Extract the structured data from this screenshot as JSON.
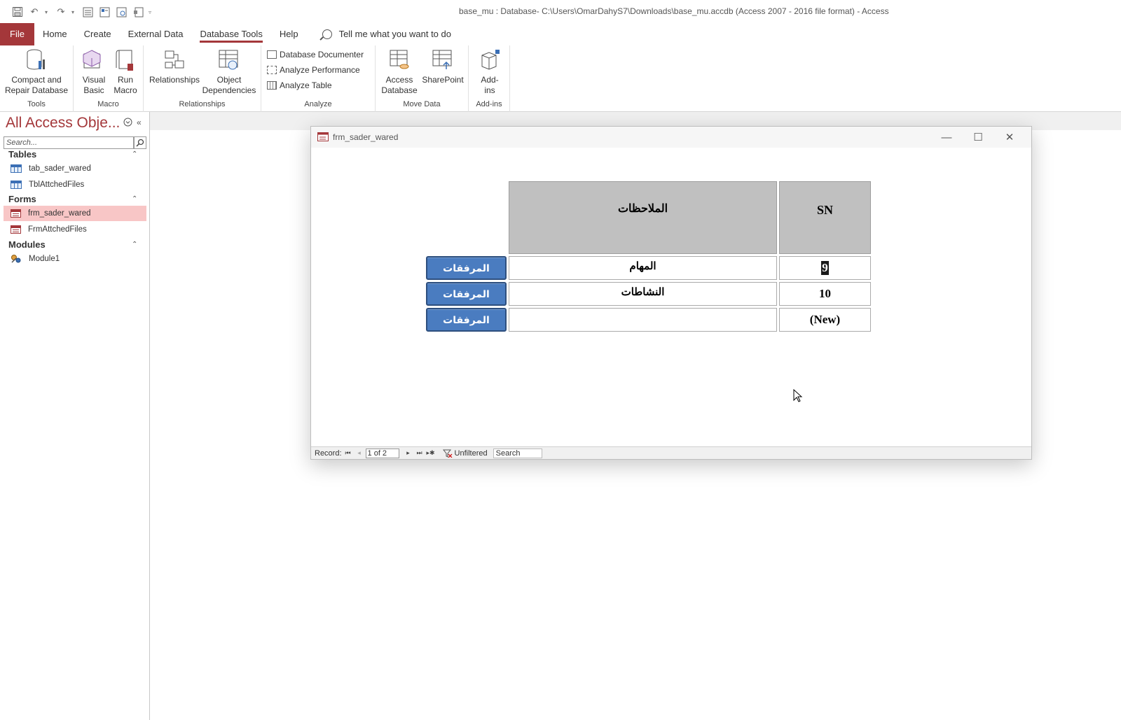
{
  "titlebar": {
    "title": "base_mu : Database- C:\\Users\\OmarDahyS7\\Downloads\\base_mu.accdb (Access 2007 - 2016 file format)  -  Access"
  },
  "tabs": [
    {
      "label": "File"
    },
    {
      "label": "Home"
    },
    {
      "label": "Create"
    },
    {
      "label": "External Data"
    },
    {
      "label": "Database Tools"
    },
    {
      "label": "Help"
    }
  ],
  "tellme": {
    "label": "Tell me what you want to do"
  },
  "ribbon": {
    "tools": {
      "label": "Tools",
      "compact": "Compact and Repair Database"
    },
    "macro": {
      "label": "Macro",
      "vb": "Visual Basic",
      "run": "Run Macro"
    },
    "relationships": {
      "label": "Relationships",
      "rel": "Relationships",
      "deps": "Object Dependencies"
    },
    "analyze": {
      "label": "Analyze",
      "documenter": "Database Documenter",
      "performance": "Analyze Performance",
      "table": "Analyze Table"
    },
    "movedata": {
      "label": "Move Data",
      "access": "Access Database",
      "sharepoint": "SharePoint"
    },
    "addins": {
      "label": "Add-ins",
      "addins": "Add-ins"
    }
  },
  "nav": {
    "title": "All Access Obje...",
    "search_placeholder": "Search...",
    "tables_label": "Tables",
    "tables": [
      "tab_sader_wared",
      "TblAttchedFiles"
    ],
    "forms_label": "Forms",
    "forms": [
      "frm_sader_wared",
      "FrmAttchedFiles"
    ],
    "modules_label": "Modules",
    "modules": [
      "Module1"
    ]
  },
  "form": {
    "title": "frm_sader_wared",
    "header_notes": "الملاحظات",
    "header_sn": "SN",
    "rows": [
      {
        "sn_pre": "",
        "sn_sel": "9",
        "note": "المهام",
        "button": "المرفقات"
      },
      {
        "sn_pre": "10",
        "sn_sel": "",
        "note": "النشاطات",
        "button": "المرفقات"
      },
      {
        "sn_pre": "(New)",
        "sn_sel": "",
        "note": "",
        "button": "المرفقات"
      }
    ],
    "recordbar": {
      "label": "Record:",
      "position": "1 of 2",
      "filter": "Unfiltered",
      "search": "Search"
    }
  },
  "colors": {
    "accent": "#a4373a",
    "button": "#4a7cc0",
    "header": "#c0c0c0",
    "selected": "#f8c6c6"
  }
}
